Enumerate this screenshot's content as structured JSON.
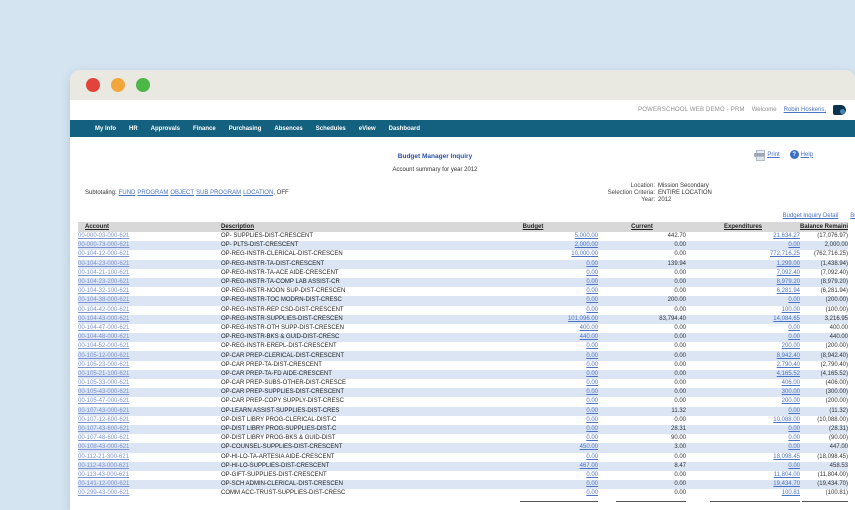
{
  "chrome": {
    "app_title": "POWERSCHOOL WEB DEMO - PRM",
    "welcome_label": "Welcome",
    "user_link": "Robin Hoskens,"
  },
  "nav": {
    "items": [
      "My Info",
      "HR",
      "Approvals",
      "Finance",
      "Purchasing",
      "Absences",
      "Schedules",
      "eView",
      "Dashboard"
    ]
  },
  "page": {
    "title": "Budget Manager Inquiry",
    "subtitle": "Account summary for year 2012",
    "print_label": "Print",
    "help_label": "Help",
    "help_glyph": "?",
    "subtotaling_label": "Subtotaling:",
    "subtotaling_links": [
      "FUND",
      "PROGRAM",
      "OBJECT",
      "SUB PROGRAM",
      "LOCATION"
    ],
    "subtotaling_suffix": ", OFF",
    "criteria": [
      {
        "label": "Location:",
        "value": "Mission Secondary"
      },
      {
        "label": "Selection Criteria:",
        "value": "ENTIRE LOCATION"
      },
      {
        "label": "Year:",
        "value": "2012"
      }
    ],
    "inquiry_links": [
      "Budget Inquiry Detail",
      "Budget Inquiry"
    ]
  },
  "table": {
    "columns": [
      "Account",
      "Description",
      "Budget",
      "Current",
      "Expenditures",
      "Balance Remaining"
    ],
    "rows": [
      {
        "account": "00-000-03-000-621",
        "description": "OP- SUPPLIES-DIST-CRESCENT",
        "budget": "5,000.00",
        "current": "442.70",
        "expenditures": "21,634.27",
        "balance": "(17,076.97)"
      },
      {
        "account": "00-000-73-000-621",
        "description": "OP- PLTS-DIST-CRESCENT",
        "budget": "2,000.00",
        "current": "0.00",
        "expenditures": "0.00",
        "balance": "2,000.00"
      },
      {
        "account": "00-104-12-000-621",
        "description": "OP-REG-INSTR-CLERICAL-DIST-CRESCEN",
        "budget": "10,000.00",
        "current": "0.00",
        "expenditures": "772,716.25",
        "balance": "(762,716.25)"
      },
      {
        "account": "00-104-23-000-621",
        "description": "OP-REG-INSTR-TA-DIST-CRESCENT",
        "budget": "0.00",
        "current": "139.94",
        "expenditures": "1,299.00",
        "balance": "(1,438.94)"
      },
      {
        "account": "00-104-21-100-621",
        "description": "OP-REG-INSTR-TA-ACE AIDE-CRESCENT",
        "budget": "0.00",
        "current": "0.00",
        "expenditures": "7,092.40",
        "balance": "(7,092.40)"
      },
      {
        "account": "00-104-23-200-621",
        "description": "OP-REG-INSTR-TA-COMP LAB ASSIST-CR",
        "budget": "0.00",
        "current": "0.00",
        "expenditures": "8,979.20",
        "balance": "(8,979.20)"
      },
      {
        "account": "00-104-32-100-621",
        "description": "OP-REG-INSTR-NOON SUP-DIST-CRESCEN",
        "budget": "0.00",
        "current": "0.00",
        "expenditures": "6,281.94",
        "balance": "(6,281.94)"
      },
      {
        "account": "00-104-38-000-621",
        "description": "OP-REG-INSTR-TOC MODRN-DIST-CRESC",
        "budget": "0.00",
        "current": "200.00",
        "expenditures": "0.00",
        "balance": "(200.00)"
      },
      {
        "account": "00-104-42-000-621",
        "description": "OP-REG-INSTR-REP CSD-DIST-CRESCENT",
        "budget": "0.00",
        "current": "0.00",
        "expenditures": "100.00",
        "balance": "(100.00)"
      },
      {
        "account": "00-104-43-000-621",
        "description": "OP-REG-INSTR-SUPPLIES-DIST-CRESCEN",
        "budget": "101,096.00",
        "current": "83,794.40",
        "expenditures": "14,084.65",
        "balance": "3,216.95"
      },
      {
        "account": "00-104-47-000-621",
        "description": "OP-REG-INSTR-OTH SUPP-DIST-CRESCEN",
        "budget": "400.00",
        "current": "0.00",
        "expenditures": "0.00",
        "balance": "400.00"
      },
      {
        "account": "00-104-48-000-621",
        "description": "OP-REG-INSTR-BKS & GUID-DIST-CRESC",
        "budget": "440.00",
        "current": "0.00",
        "expenditures": "0.00",
        "balance": "440.00"
      },
      {
        "account": "00-104-52-000-621",
        "description": "OP-REG-INSTR-EREPL-DIST-CRESCENT",
        "budget": "0.00",
        "current": "0.00",
        "expenditures": "200.00",
        "balance": "(200.00)"
      },
      {
        "account": "00-105-12-000-621",
        "description": "OP-CAR PREP-CLERICAL-DIST-CRESCENT",
        "budget": "0.00",
        "current": "0.00",
        "expenditures": "8,942.40",
        "balance": "(8,942.40)"
      },
      {
        "account": "00-105-23-000-621",
        "description": "OP-CAR PREP-TA-DIST-CRESCENT",
        "budget": "0.00",
        "current": "0.00",
        "expenditures": "2,790.40",
        "balance": "(2,790.40)"
      },
      {
        "account": "00-105-21-100-621",
        "description": "OP-CAR PREP-TA-FD AIDE-CRESCENT",
        "budget": "0.00",
        "current": "0.00",
        "expenditures": "4,165.52",
        "balance": "(4,165.52)"
      },
      {
        "account": "00-105-33-000-621",
        "description": "OP-CAR PREP-SUBS-OTHER-DIST-CRESCE",
        "budget": "0.00",
        "current": "0.00",
        "expenditures": "406.00",
        "balance": "(406.00)"
      },
      {
        "account": "00-105-43-000-621",
        "description": "OP-CAR PREP-SUPPLIES-DIST-CRESCENT",
        "budget": "0.00",
        "current": "0.00",
        "expenditures": "300.00",
        "balance": "(300.00)"
      },
      {
        "account": "00-105-47-000-621",
        "description": "OP-CAR PREP-COPY SUPPLY-DIST-CRESC",
        "budget": "0.00",
        "current": "0.00",
        "expenditures": "200.00",
        "balance": "(200.00)"
      },
      {
        "account": "00-107-43-000-621",
        "description": "OP-LEARN ASSIST-SUPPLIES-DIST-CRES",
        "budget": "0.00",
        "current": "11.32",
        "expenditures": "0.00",
        "balance": "(11.32)"
      },
      {
        "account": "00-107-12-600-621",
        "description": "OP-DIST LIBRY PROG-CLERICAL-DIST-C",
        "budget": "0.00",
        "current": "0.00",
        "expenditures": "10,088.00",
        "balance": "(10,088.00)"
      },
      {
        "account": "00-107-43-600-621",
        "description": "OP-DIST LIBRY PROG-SUPPLIES-DIST-C",
        "budget": "0.00",
        "current": "28.31",
        "expenditures": "0.00",
        "balance": "(28.31)"
      },
      {
        "account": "00-107-48-600-621",
        "description": "OP-DIST LIBRY PROG-BKS & GUID-DIST",
        "budget": "0.00",
        "current": "90.00",
        "expenditures": "0.00",
        "balance": "(90.00)"
      },
      {
        "account": "00-108-43-000-621",
        "description": "OP-COUNSEL-SUPPLIES-DIST-CRESCENT",
        "budget": "450.00",
        "current": "3.00",
        "expenditures": "0.00",
        "balance": "447.00"
      },
      {
        "account": "00-112-21-300-621",
        "description": "OP-HI-LO-TA-ARTESIA AIDE-CRESCENT",
        "budget": "0.00",
        "current": "0.00",
        "expenditures": "18,098.45",
        "balance": "(18,098.45)"
      },
      {
        "account": "00-112-43-000-621",
        "description": "OP-HI-LO-SUPPLIES-DIST-CRESCENT",
        "budget": "467.00",
        "current": "8.47",
        "expenditures": "0.00",
        "balance": "458.53"
      },
      {
        "account": "00-113-43-000-621",
        "description": "OP-GIFT-SUPPLIES-DIST-CRESCENT",
        "budget": "0.00",
        "current": "0.00",
        "expenditures": "11,804.00",
        "balance": "(11,804.00)"
      },
      {
        "account": "00-141-12-000-621",
        "description": "OP-SCH ADMIN-CLERICAL-DIST-CRESCEN",
        "budget": "0.00",
        "current": "0.00",
        "expenditures": "19,434.70",
        "balance": "(19,434.70)"
      },
      {
        "account": "00-299-43-000-621",
        "description": "COMM ACC-TRUST-SUPPLIES-DIST-CRESC",
        "budget": "0.00",
        "current": "0.00",
        "expenditures": "100.81",
        "balance": "(100.81)"
      }
    ]
  },
  "colors": {
    "background": "#d5e4f1",
    "navbar": "#14607f",
    "title_blue": "#2b51a5",
    "link_blue": "#4a73c4",
    "account_link": "#7d93cf",
    "row_alt": "#dbe5f4",
    "header_gray": "#d8d8d8",
    "dot_red": "#e2443b",
    "dot_yellow": "#f2a73d",
    "dot_green": "#4cb647"
  }
}
